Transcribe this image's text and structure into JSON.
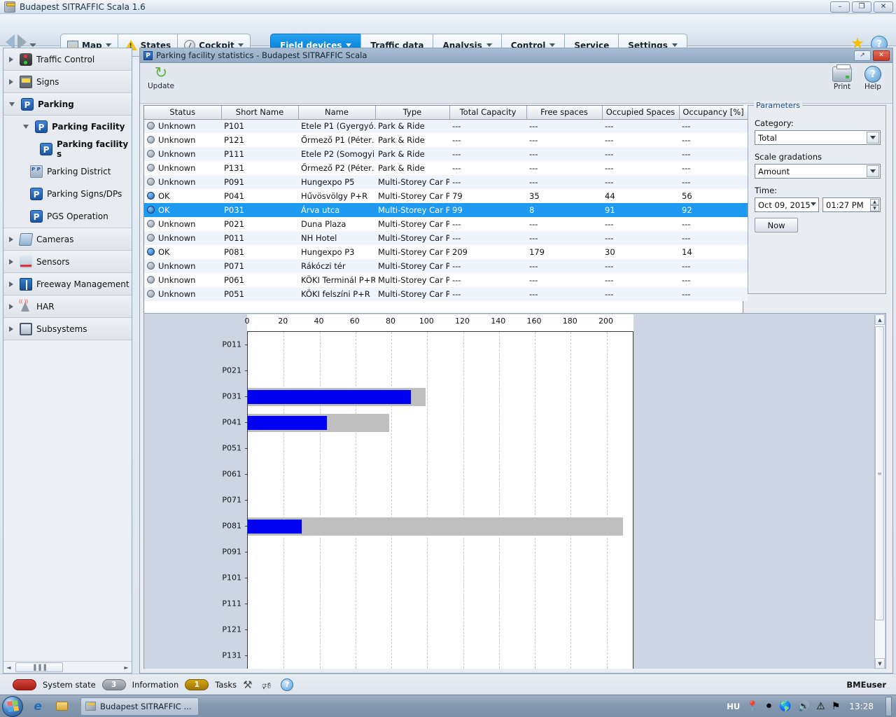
{
  "window": {
    "title": "Budapest SITRAFFIC Scala 1.6",
    "minimize": "–",
    "restore": "❐",
    "close": "✕"
  },
  "toolbar": {
    "back_icon": "back-arrow-icon",
    "forward_icon": "forward-arrow-icon",
    "buttons": [
      {
        "label": "Map",
        "icon": "map-icon",
        "has_caret": true
      },
      {
        "label": "States",
        "icon": "warning-triangle-icon",
        "has_caret": false
      },
      {
        "label": "Cockpit",
        "icon": "gauge-icon",
        "has_caret": true
      }
    ],
    "menus": [
      {
        "label": "Field devices",
        "active": true,
        "has_caret": true
      },
      {
        "label": "Traffic data",
        "active": false,
        "has_caret": false
      },
      {
        "label": "Analysis",
        "active": false,
        "has_caret": true
      },
      {
        "label": "Control",
        "active": false,
        "has_caret": true
      },
      {
        "label": "Service",
        "active": false,
        "has_caret": false
      },
      {
        "label": "Settings",
        "active": false,
        "has_caret": true
      }
    ],
    "favorite_icon": "star-icon",
    "help_icon": "help-icon",
    "help_glyph": "?"
  },
  "sidebar": {
    "items": [
      {
        "label": "Traffic Control",
        "icon": "traffic-light-icon",
        "expanded": false,
        "level": 0
      },
      {
        "label": "Signs",
        "icon": "sign-icon",
        "expanded": false,
        "level": 0
      },
      {
        "label": "Parking",
        "icon": "parking-icon",
        "expanded": true,
        "level": 0
      },
      {
        "label": "Parking Facility",
        "icon": "parking-icon",
        "expanded": true,
        "level": 1
      },
      {
        "label": "Parking facility s",
        "icon": "parking-icon",
        "expanded": false,
        "level": 2
      },
      {
        "label": "Parking District",
        "icon": "parking-district-icon",
        "expanded": false,
        "level": 1
      },
      {
        "label": "Parking Signs/DPs",
        "icon": "parking-sign-icon",
        "expanded": false,
        "level": 1
      },
      {
        "label": "PGS Operation",
        "icon": "pgs-operation-icon",
        "expanded": false,
        "level": 1
      },
      {
        "label": "Cameras",
        "icon": "camera-icon",
        "expanded": false,
        "level": 0
      },
      {
        "label": "Sensors",
        "icon": "sensor-icon",
        "expanded": false,
        "level": 0
      },
      {
        "label": "Freeway Management",
        "icon": "freeway-icon",
        "expanded": false,
        "level": 0
      },
      {
        "label": "HAR",
        "icon": "har-antenna-icon",
        "expanded": false,
        "level": 0
      },
      {
        "label": "Subsystems",
        "icon": "monitor-icon",
        "expanded": false,
        "level": 0
      }
    ],
    "scroll_left_icon": "◄",
    "scroll_right_icon": "►",
    "scroll_grip": "▐▐▐"
  },
  "inner_window": {
    "title": "Parking facility statistics - Budapest SITRAFFIC Scala",
    "icon": "parking-icon",
    "restore_label": "↗",
    "close_label": "✕",
    "update_label": "Update",
    "update_icon": "refresh-icon",
    "update_glyph": "↻",
    "print_label": "Print",
    "help_label": "Help",
    "help_glyph": "?"
  },
  "table": {
    "columns": [
      "Status",
      "Short Name",
      "Name",
      "Type",
      "Total Capacity",
      "Free spaces",
      "Occupied Spaces",
      "Occupancy [%]"
    ],
    "rows": [
      {
        "status": "Unknown",
        "state": "unknown",
        "short": "P101",
        "name": "Etele P1 (Gyergyó…",
        "type": "Park & Ride",
        "capacity": "---",
        "free": "---",
        "occupied": "---",
        "pct": "---",
        "selected": false
      },
      {
        "status": "Unknown",
        "state": "unknown",
        "short": "P121",
        "name": "Őrmező P1 (Péter…",
        "type": "Park & Ride",
        "capacity": "---",
        "free": "---",
        "occupied": "---",
        "pct": "---",
        "selected": false
      },
      {
        "status": "Unknown",
        "state": "unknown",
        "short": "P111",
        "name": "Etele P2 (Somogyi …",
        "type": "Park & Ride",
        "capacity": "---",
        "free": "---",
        "occupied": "---",
        "pct": "---",
        "selected": false
      },
      {
        "status": "Unknown",
        "state": "unknown",
        "short": "P131",
        "name": "Őrmező P2 (Péter…",
        "type": "Park & Ride",
        "capacity": "---",
        "free": "---",
        "occupied": "---",
        "pct": "---",
        "selected": false
      },
      {
        "status": "Unknown",
        "state": "unknown",
        "short": "P091",
        "name": "Hungexpo P5",
        "type": "Multi-Storey Car P…",
        "capacity": "---",
        "free": "---",
        "occupied": "---",
        "pct": "---",
        "selected": false
      },
      {
        "status": "OK",
        "state": "ok",
        "short": "P041",
        "name": "Hűvösvölgy P+R",
        "type": "Multi-Storey Car P…",
        "capacity": "79",
        "free": "35",
        "occupied": "44",
        "pct": "56",
        "selected": false
      },
      {
        "status": "OK",
        "state": "ok",
        "short": "P031",
        "name": "Árva utca",
        "type": "Multi-Storey Car P…",
        "capacity": "99",
        "free": "8",
        "occupied": "91",
        "pct": "92",
        "selected": true
      },
      {
        "status": "Unknown",
        "state": "unknown",
        "short": "P021",
        "name": "Duna Plaza",
        "type": "Multi-Storey Car P…",
        "capacity": "---",
        "free": "---",
        "occupied": "---",
        "pct": "---",
        "selected": false
      },
      {
        "status": "Unknown",
        "state": "unknown",
        "short": "P011",
        "name": "NH Hotel",
        "type": "Multi-Storey Car P…",
        "capacity": "---",
        "free": "---",
        "occupied": "---",
        "pct": "---",
        "selected": false
      },
      {
        "status": "OK",
        "state": "ok",
        "short": "P081",
        "name": "Hungexpo P3",
        "type": "Multi-Storey Car P…",
        "capacity": "209",
        "free": "179",
        "occupied": "30",
        "pct": "14",
        "selected": false
      },
      {
        "status": "Unknown",
        "state": "unknown",
        "short": "P071",
        "name": "Rákóczi tér",
        "type": "Multi-Storey Car P…",
        "capacity": "---",
        "free": "---",
        "occupied": "---",
        "pct": "---",
        "selected": false
      },
      {
        "status": "Unknown",
        "state": "unknown",
        "short": "P061",
        "name": "KÖKI Terminál P+R",
        "type": "Multi-Storey Car P…",
        "capacity": "---",
        "free": "---",
        "occupied": "---",
        "pct": "---",
        "selected": false
      },
      {
        "status": "Unknown",
        "state": "unknown",
        "short": "P051",
        "name": "KÖKI felszíni P+R",
        "type": "Multi-Storey Car P…",
        "capacity": "---",
        "free": "---",
        "occupied": "---",
        "pct": "---",
        "selected": false
      }
    ]
  },
  "parameters": {
    "title": "Parameters",
    "category_label": "Category:",
    "category_value": "Total",
    "scale_label": "Scale gradations",
    "scale_value": "Amount",
    "time_label": "Time:",
    "date_value": "Oct 09, 2015",
    "time_value": "01:27 PM",
    "now_label": "Now"
  },
  "chart_data": {
    "type": "bar",
    "orientation": "horizontal",
    "title": "",
    "xlabel": "",
    "ylabel": "",
    "xlim": [
      0,
      215
    ],
    "xticks": [
      0,
      20,
      40,
      60,
      80,
      100,
      120,
      140,
      160,
      180,
      200
    ],
    "grid": true,
    "legend": "none",
    "categories": [
      "P011",
      "P021",
      "P031",
      "P041",
      "P051",
      "P061",
      "P071",
      "P081",
      "P091",
      "P101",
      "P111",
      "P121",
      "P131"
    ],
    "series": [
      {
        "name": "Total Capacity",
        "color": "#bfbfbf",
        "values": [
          null,
          null,
          99,
          79,
          null,
          null,
          null,
          209,
          null,
          null,
          null,
          null,
          null
        ]
      },
      {
        "name": "Occupied Spaces",
        "color": "#0000f0",
        "values": [
          null,
          null,
          91,
          44,
          null,
          null,
          null,
          30,
          null,
          null,
          null,
          null,
          null
        ]
      }
    ]
  },
  "chart_scroll": {
    "up_icon": "▲",
    "down_icon": "▼",
    "grip": "≡"
  },
  "statusbar": {
    "system_state_label": "System state",
    "system_state_color": "#b5221a",
    "information_count": "3",
    "information_label": "Information",
    "tasks_count": "1",
    "tasks_label": "Tasks",
    "tools_icon": "tools-icon",
    "mute_icon": "mute-bell-icon",
    "help_icon": "help-icon",
    "help_glyph": "?",
    "user": "BMEuser"
  },
  "taskbar": {
    "start_label": "start-orb",
    "quick_launch": [
      {
        "label": "Internet Explorer",
        "icon": "ie-icon",
        "glyph": "e"
      },
      {
        "label": "Windows Explorer",
        "icon": "folder-icon"
      }
    ],
    "task_button": "Budapest SITRAFFIC ...",
    "tray_language": "HU",
    "tray_icons": [
      "pin-icon",
      "network-alert-icon",
      "globe-icon",
      "volume-icon",
      "update-warning-icon",
      "flag-alert-icon"
    ],
    "clock": "13:28"
  }
}
